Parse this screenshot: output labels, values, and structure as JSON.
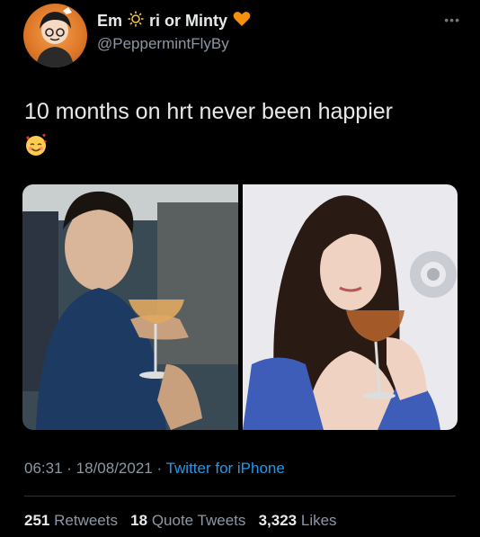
{
  "author": {
    "name_before": "Em",
    "name_after": "ri or Minty",
    "handle": "@PeppermintFlyBy",
    "sun_icon": "sun-icon",
    "heart_icon": "orange-heart-icon",
    "avatar_icon": "avatar-illustration"
  },
  "tweet": {
    "text": "10 months on hrt never been happier",
    "emoji_icon": "smiling-face-with-hearts-emoji"
  },
  "media": {
    "photos": [
      "before-photo",
      "after-photo"
    ]
  },
  "meta": {
    "time": "06:31",
    "sep1": " · ",
    "date": "18/08/2021",
    "sep2": " · ",
    "source": "Twitter for iPhone"
  },
  "stats": {
    "retweets_count": "251",
    "retweets_label": "Retweets",
    "quotes_count": "18",
    "quotes_label": "Quote Tweets",
    "likes_count": "3,323",
    "likes_label": "Likes"
  },
  "colors": {
    "background": "#000000",
    "text": "#e7e9ea",
    "secondary": "#8b98a5",
    "link": "#1d9bf0",
    "heart": "#f4900c"
  }
}
